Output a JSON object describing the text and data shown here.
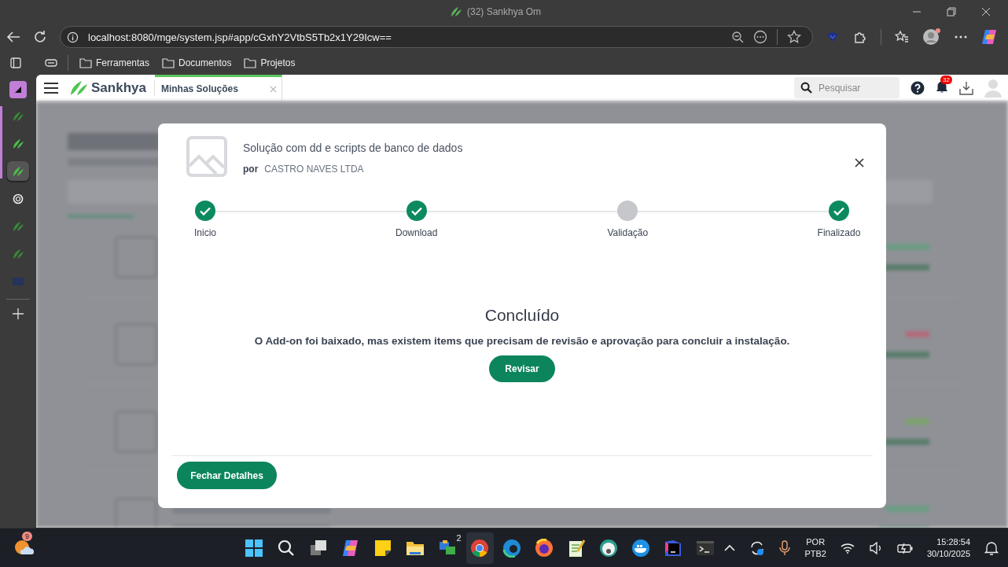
{
  "browser": {
    "title": "(32) Sankhya Om",
    "url": "localhost:8080/mge/system.jsp#app/cGxhY2VtbS5Tb2x1Y29Icw==",
    "bookmarks": [
      "Ferramentas",
      "Documentos",
      "Projetos"
    ]
  },
  "app": {
    "brand": "Sankhya",
    "tabs": [
      {
        "label": "Minhas Soluções",
        "selected": true
      }
    ],
    "search": {
      "placeholder": "Pesquisar"
    },
    "notification_count": "32"
  },
  "modal": {
    "title": "Solução com dd e scripts de banco de dados",
    "by_label": "por",
    "vendor": "CASTRO NAVES LTDA",
    "steps": [
      {
        "label": "Inicio",
        "done": true
      },
      {
        "label": "Download",
        "done": true
      },
      {
        "label": "Validação",
        "done": false
      },
      {
        "label": "Finalizado",
        "done": true
      }
    ],
    "status_title": "Concluído",
    "message": "O Add-on foi baixado, mas existem items que precisam de revisão e aprovação para concluir a instalação.",
    "review_button": "Revisar",
    "close_button": "Fechar Detalhes"
  },
  "taskbar": {
    "weather_badge": "9",
    "chat_badge": "2",
    "language": "POR",
    "layout": "PTB2",
    "time": "15:28:54",
    "date": "30/10/2025"
  }
}
